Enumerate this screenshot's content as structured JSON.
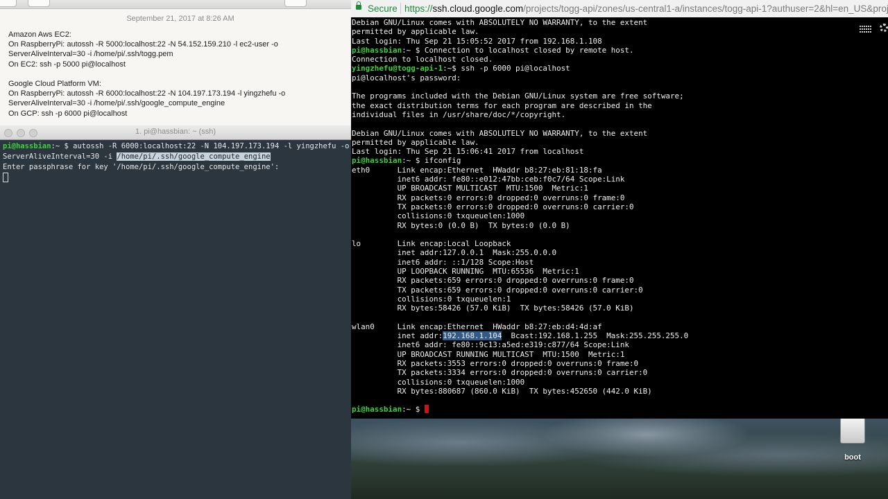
{
  "notes": {
    "date": "September 21, 2017 at 8:26 AM",
    "lines": [
      "Amazon Aws EC2:",
      "On RaspberryPi: autossh -R 5000:localhost:22 -N 54.152.159.210 -l ec2-user -o",
      "ServerAliveInterval=30 -i /home/pi/.ssh/togg.pem",
      "On EC2: ssh -p 5000 pi@localhost",
      "",
      "Google Cloud Platform VM:",
      "On RaspberryPi: autossh -R 6000:localhost:22 -N 104.197.173.194 -l yingzhefu -o",
      "ServerAliveInterval=30 -i /home/pi/.ssh/google_compute_engine",
      "On GCP: ssh -p 6000 pi@localhost"
    ]
  },
  "local_terminal": {
    "title": "1. pi@hassbian: ~ (ssh)",
    "prompt_user": "pi@hassbian",
    "prompt_rest": ":~ $ ",
    "command": "autossh -R 6000:localhost:22 -N 104.197.173.194 -l yingzhefu -o",
    "line2_a": "ServerAliveInterval=30 -i ",
    "line2_hl": "/home/pi/.ssh/google_compute_engine",
    "line3": "Enter passphrase for key '/home/pi/.ssh/google_compute_engine':"
  },
  "browser": {
    "secure_label": "Secure",
    "url_scheme": "https://",
    "url_host": "ssh.cloud.google.com",
    "url_path": "/projects/togg-api/zones/us-central1-a/instances/togg-api-1?authuser=2&hl=en_US&projec"
  },
  "cloud_shell": {
    "lines": [
      {
        "t": "Debian GNU/Linux comes with ABSOLUTELY NO WARRANTY, to the extent"
      },
      {
        "t": "permitted by applicable law."
      },
      {
        "t": "Last login: Thu Sep 21 15:05:52 2017 from 192.168.1.108"
      },
      {
        "p": "pi@hassbian",
        "r": ":~ $ ",
        "t": "Connection to localhost closed by remote host."
      },
      {
        "t": "Connection to localhost closed."
      },
      {
        "p": "yingzhefu@togg-api-1",
        "r": ":~$ ",
        "t": "ssh -p 6000 pi@localhost"
      },
      {
        "t": "pi@localhost's password:"
      },
      {
        "t": ""
      },
      {
        "t": "The programs included with the Debian GNU/Linux system are free software;"
      },
      {
        "t": "the exact distribution terms for each program are described in the"
      },
      {
        "t": "individual files in /usr/share/doc/*/copyright."
      },
      {
        "t": ""
      },
      {
        "t": "Debian GNU/Linux comes with ABSOLUTELY NO WARRANTY, to the extent"
      },
      {
        "t": "permitted by applicable law."
      },
      {
        "t": "Last login: Thu Sep 21 15:06:41 2017 from localhost"
      },
      {
        "p": "pi@hassbian",
        "r": ":~ $ ",
        "t": "ifconfig"
      },
      {
        "t": "eth0      Link encap:Ethernet  HWaddr b8:27:eb:81:18:fa"
      },
      {
        "t": "          inet6 addr: fe80::e012:47bb:ceb:f0c7/64 Scope:Link"
      },
      {
        "t": "          UP BROADCAST MULTICAST  MTU:1500  Metric:1"
      },
      {
        "t": "          RX packets:0 errors:0 dropped:0 overruns:0 frame:0"
      },
      {
        "t": "          TX packets:0 errors:0 dropped:0 overruns:0 carrier:0"
      },
      {
        "t": "          collisions:0 txqueuelen:1000"
      },
      {
        "t": "          RX bytes:0 (0.0 B)  TX bytes:0 (0.0 B)"
      },
      {
        "t": ""
      },
      {
        "t": "lo        Link encap:Local Loopback"
      },
      {
        "t": "          inet addr:127.0.0.1  Mask:255.0.0.0"
      },
      {
        "t": "          inet6 addr: ::1/128 Scope:Host"
      },
      {
        "t": "          UP LOOPBACK RUNNING  MTU:65536  Metric:1"
      },
      {
        "t": "          RX packets:659 errors:0 dropped:0 overruns:0 frame:0"
      },
      {
        "t": "          TX packets:659 errors:0 dropped:0 overruns:0 carrier:0"
      },
      {
        "t": "          collisions:0 txqueuelen:1"
      },
      {
        "t": "          RX bytes:58426 (57.0 KiB)  TX bytes:58426 (57.0 KiB)"
      },
      {
        "t": ""
      },
      {
        "t": "wlan0     Link encap:Ethernet  HWaddr b8:27:eb:d4:4d:af"
      },
      {
        "t": "          inet addr:",
        "sel": "192.168.1.104",
        "t2": "  Bcast:192.168.1.255  Mask:255.255.255.0"
      },
      {
        "t": "          inet6 addr: fe80::9c13:a5ed:e319:c877/64 Scope:Link"
      },
      {
        "t": "          UP BROADCAST RUNNING MULTICAST  MTU:1500  Metric:1"
      },
      {
        "t": "          RX packets:3553 errors:0 dropped:0 overruns:0 frame:0"
      },
      {
        "t": "          TX packets:3334 errors:0 dropped:0 overruns:0 carrier:0"
      },
      {
        "t": "          collisions:0 txqueuelen:1000"
      },
      {
        "t": "          RX bytes:880687 (860.0 KiB)  TX bytes:452650 (442.0 KiB)"
      },
      {
        "t": ""
      },
      {
        "p": "pi@hassbian",
        "r": ":~ $ ",
        "t": "",
        "cursor": true
      }
    ]
  },
  "desktop": {
    "icon_label": "boot"
  }
}
